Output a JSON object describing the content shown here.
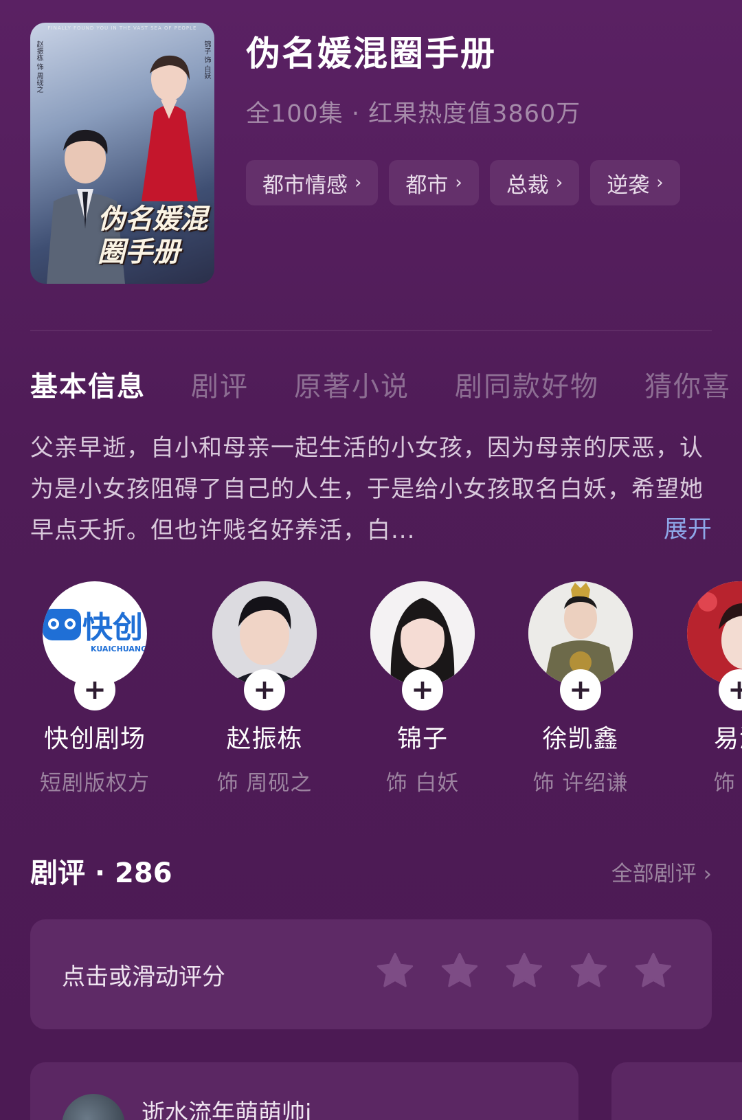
{
  "drama": {
    "title": "伪名媛混圈手册",
    "subtitle": "全100集 · 红果热度值3860万",
    "poster": {
      "tagline": "FINALLY FOUND YOU IN THE VAST SEA OF PEOPLE",
      "credit_left": "赵振栋 饰 周砚之",
      "credit_right": "锦子 饰 白妖",
      "title": "伪名媛混圈手册"
    }
  },
  "tags": [
    {
      "label": "都市情感"
    },
    {
      "label": "都市"
    },
    {
      "label": "总裁"
    },
    {
      "label": "逆袭"
    }
  ],
  "tabs": [
    "基本信息",
    "剧评",
    "原著小说",
    "剧同款好物",
    "猜你喜"
  ],
  "synopsis": {
    "text": "父亲早逝，自小和母亲一起生活的小女孩，因为母亲的厌恶，认为是小女孩阻碍了自己的人生，于是给小女孩取名白妖，希望她早点夭折。但也许贱名好养活，白...",
    "expand": "展开"
  },
  "cast": [
    {
      "name": "快创剧场",
      "role": "短剧版权方",
      "logo_text": "快创",
      "logo_sub": "KUAICHUANG"
    },
    {
      "name": "赵振栋",
      "role": "饰 周砚之"
    },
    {
      "name": "锦子",
      "role": "饰 白妖"
    },
    {
      "name": "徐凯鑫",
      "role": "饰 许绍谦"
    },
    {
      "name": "易沁",
      "role": "饰 许"
    }
  ],
  "reviews": {
    "header": "剧评 · 286",
    "all_label": "全部剧评",
    "rate_prompt": "点击或滑动评分",
    "rating": 0,
    "max_rating": 5,
    "first_comment_user": "逝水流年萌萌帅i"
  },
  "colors": {
    "background": "#4e1a55",
    "accent_link": "#8ea7e8",
    "tag_bg": "#64306b",
    "card_bg": "#5e2a66"
  },
  "icons": {
    "follow": "plus-icon",
    "tag_chevron": "chevron-right-icon",
    "star": "star-icon"
  }
}
